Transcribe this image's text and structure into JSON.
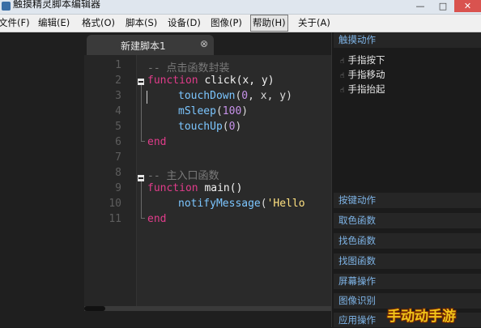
{
  "window": {
    "title": "触摸精灵脚本编辑器",
    "controls": {
      "minimize": "—",
      "maximize": "□",
      "close": "✕"
    }
  },
  "menubar": {
    "items": [
      {
        "label": "文件(F)"
      },
      {
        "label": "编辑(E)"
      },
      {
        "label": "格式(O)"
      },
      {
        "label": "脚本(S)"
      },
      {
        "label": "设备(D)"
      },
      {
        "label": "图像(P)"
      },
      {
        "label": "帮助(H)",
        "active": true
      },
      {
        "label": "关于(A)"
      }
    ]
  },
  "editor": {
    "tab": {
      "title": "新建脚本1",
      "close": "⊗"
    },
    "line_numbers": [
      "1",
      "2",
      "3",
      "4",
      "5",
      "6",
      "7",
      "8",
      "9",
      "10",
      "11"
    ],
    "code": {
      "line1": "-- 点击函数封装",
      "line2_kw": "function",
      "line2_fn": " click(x, y)",
      "line3_call": "touchDown",
      "line3_open": "(",
      "line3_num": "0",
      "line3_rest": ", x, y)",
      "line4_call": "mSleep",
      "line4_open": "(",
      "line4_num": "100",
      "line4_close": ")",
      "line5_call": "touchUp",
      "line5_open": "(",
      "line5_num": "0",
      "line5_close": ")",
      "line6_kw": "end",
      "line8": "-- 主入口函数",
      "line9_kw": "function",
      "line9_fn": " main()",
      "line10_call": "notifyMessage",
      "line10_open": "(",
      "line10_str": "'Hello",
      "line11_kw": "end"
    },
    "colors": {
      "keyword": "#e03c8a",
      "call": "#7cc6ff",
      "number": "#c792ea",
      "string": "#ffe180",
      "comment": "#7a7a7a"
    }
  },
  "panel": {
    "sections": [
      {
        "label": "触摸动作",
        "items": [
          "手指按下",
          "手指移动",
          "手指抬起"
        ]
      },
      {
        "label": "按键动作"
      },
      {
        "label": "取色函数"
      },
      {
        "label": "找色函数"
      },
      {
        "label": "找图函数"
      },
      {
        "label": "屏幕操作"
      },
      {
        "label": "图像识别"
      },
      {
        "label": "应用操作"
      }
    ],
    "item_icon": "hand-pointer-icon"
  },
  "watermark": {
    "text": "手动动手游"
  }
}
